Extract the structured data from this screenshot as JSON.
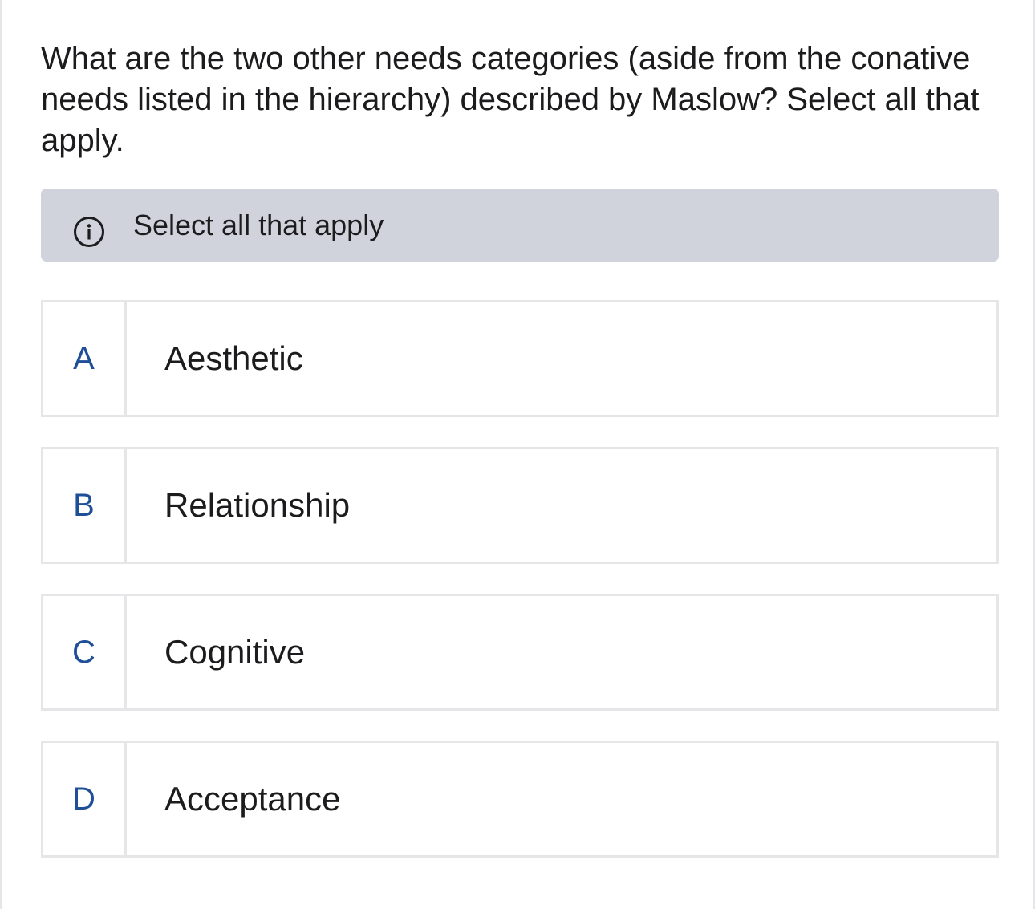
{
  "question": {
    "text": "What are the two other needs categories (aside from the conative needs listed in the hierarchy) described by Maslow? Select all that apply."
  },
  "instruction": {
    "icon": "info-icon",
    "text": "Select all that apply"
  },
  "options": [
    {
      "letter": "A",
      "label": "Aesthetic"
    },
    {
      "letter": "B",
      "label": "Relationship"
    },
    {
      "letter": "C",
      "label": "Cognitive"
    },
    {
      "letter": "D",
      "label": "Acceptance"
    }
  ],
  "colors": {
    "letter": "#1f4f96",
    "instruction_bg": "#d0d3dc",
    "border": "#e6e6e8",
    "text": "#1c1c1e"
  }
}
